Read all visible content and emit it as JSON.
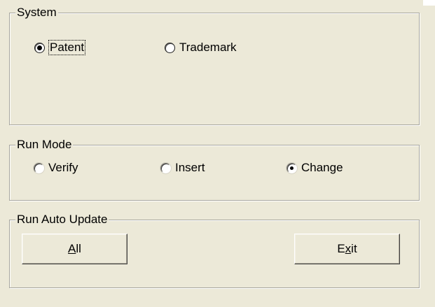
{
  "system": {
    "title": "System",
    "options": [
      {
        "label": "Patent",
        "selected": true
      },
      {
        "label": "Trademark",
        "selected": false
      }
    ]
  },
  "run_mode": {
    "title": "Run Mode",
    "options": [
      {
        "label": "Verify",
        "selected": false
      },
      {
        "label": "Insert",
        "selected": false
      },
      {
        "label": "Change",
        "selected": true
      }
    ]
  },
  "run_auto_update": {
    "title": "Run Auto Update",
    "all_button": {
      "accel": "A",
      "rest": "ll"
    },
    "exit_button": {
      "pre": "E",
      "accel": "x",
      "post": "it"
    }
  },
  "colors": {
    "window_bg": "#ece9d8",
    "groupbox_border": "#a7a69e",
    "text": "#000000"
  }
}
